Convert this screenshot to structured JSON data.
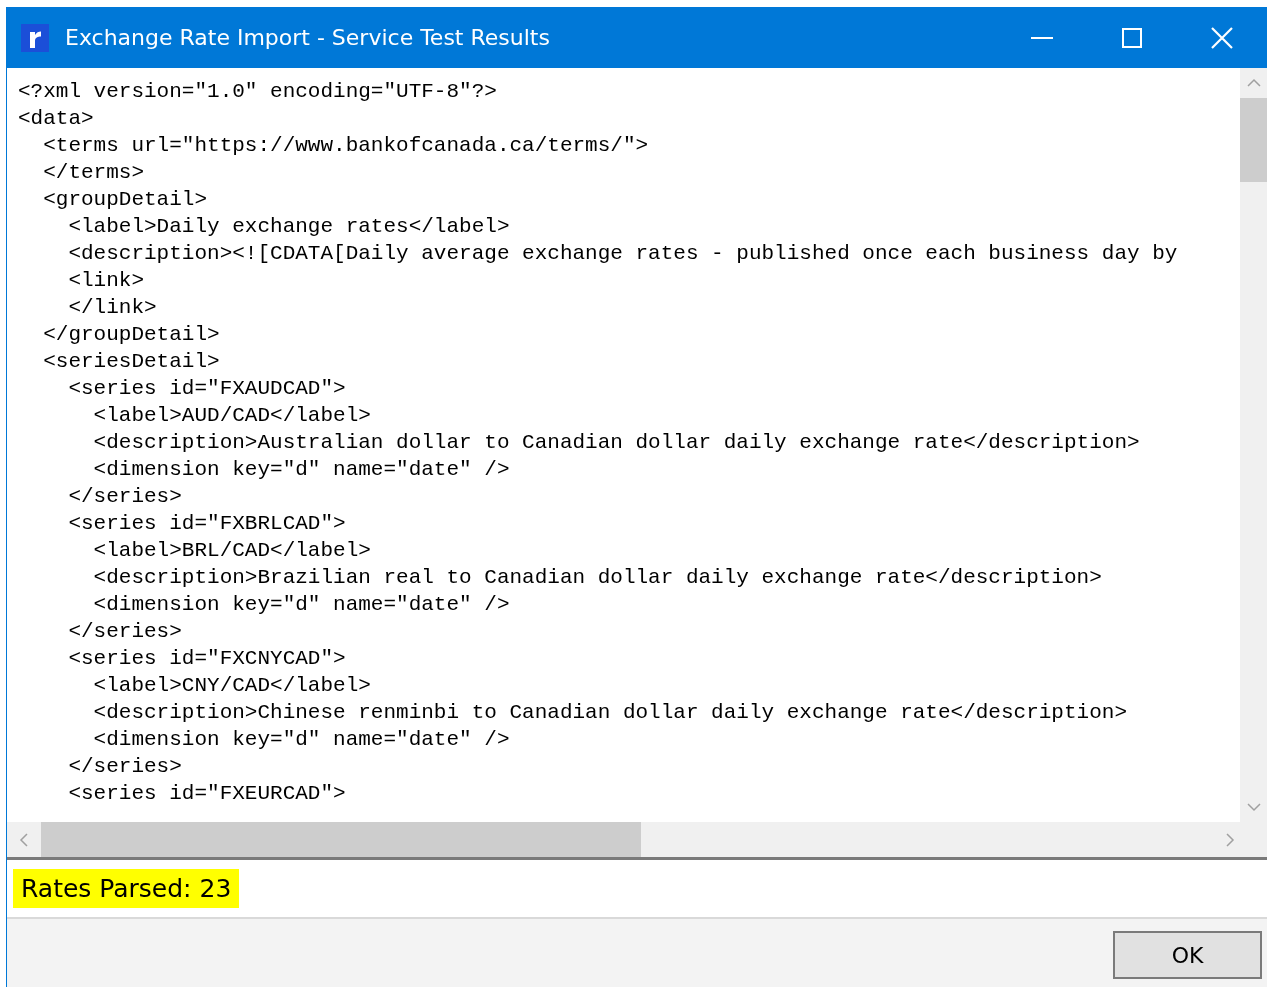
{
  "window": {
    "title": "Exchange Rate Import - Service Test Results"
  },
  "xml_lines": [
    "<?xml version=\"1.0\" encoding=\"UTF-8\"?>",
    "<data>",
    "  <terms url=\"https://www.bankofcanada.ca/terms/\">",
    "  </terms>",
    "  <groupDetail>",
    "    <label>Daily exchange rates</label>",
    "    <description><![CDATA[Daily average exchange rates - published once each business day by",
    "    <link>",
    "    </link>",
    "  </groupDetail>",
    "  <seriesDetail>",
    "    <series id=\"FXAUDCAD\">",
    "      <label>AUD/CAD</label>",
    "      <description>Australian dollar to Canadian dollar daily exchange rate</description>",
    "      <dimension key=\"d\" name=\"date\" />",
    "    </series>",
    "    <series id=\"FXBRLCAD\">",
    "      <label>BRL/CAD</label>",
    "      <description>Brazilian real to Canadian dollar daily exchange rate</description>",
    "      <dimension key=\"d\" name=\"date\" />",
    "    </series>",
    "    <series id=\"FXCNYCAD\">",
    "      <label>CNY/CAD</label>",
    "      <description>Chinese renminbi to Canadian dollar daily exchange rate</description>",
    "      <dimension key=\"d\" name=\"date\" />",
    "    </series>",
    "    <series id=\"FXEURCAD\">"
  ],
  "status": {
    "text": "Rates Parsed: 23"
  },
  "buttons": [
    "OK"
  ]
}
